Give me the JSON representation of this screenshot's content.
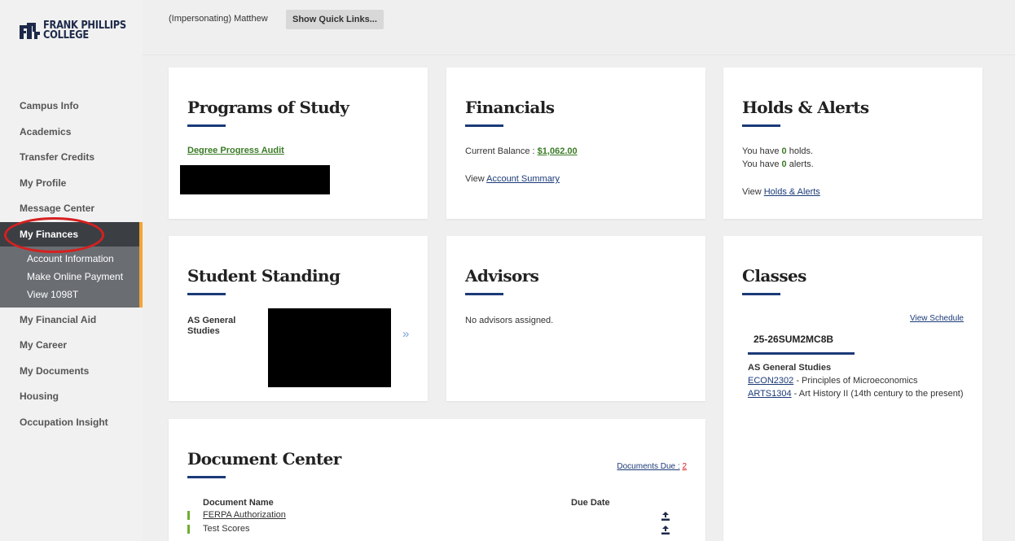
{
  "logo": {
    "line1": "FRANK PHILLIPS",
    "line2": "COLLEGE"
  },
  "sidebar": {
    "items": [
      {
        "label": "Campus Info"
      },
      {
        "label": "Academics"
      },
      {
        "label": "Transfer Credits"
      },
      {
        "label": "My Profile"
      },
      {
        "label": "Message Center"
      },
      {
        "label": "My Finances"
      },
      {
        "label": "My Financial Aid"
      },
      {
        "label": "My Career"
      },
      {
        "label": "My Documents"
      },
      {
        "label": "Housing"
      },
      {
        "label": "Occupation Insight"
      }
    ],
    "submenu": [
      {
        "label": "Account Information"
      },
      {
        "label": "Make Online Payment"
      },
      {
        "label": "View 1098T"
      }
    ]
  },
  "topbar": {
    "impersonating": "(Impersonating) Matthew",
    "quick_links": "Show Quick Links..."
  },
  "cards": {
    "programs": {
      "title": "Programs of Study",
      "link": "Degree Progress Audit"
    },
    "financials": {
      "title": "Financials",
      "balance_label": "Current Balance :",
      "balance_value": "$1,062.00",
      "view": "View",
      "account_summary": "Account Summary"
    },
    "holds": {
      "title": "Holds & Alerts",
      "holds_prefix": "You have",
      "holds_count": "0",
      "holds_suffix": "holds.",
      "alerts_prefix": "You have",
      "alerts_count": "0",
      "alerts_suffix": "alerts.",
      "view": "View",
      "link": "Holds & Alerts"
    },
    "standing": {
      "title": "Student Standing",
      "program_line1": "AS General",
      "program_line2": "Studies",
      "arrow": "»"
    },
    "advisors": {
      "title": "Advisors",
      "message": "No advisors assigned."
    },
    "classes": {
      "title": "Classes",
      "view_schedule": "View Schedule",
      "term": "25-26SUM2MC8B",
      "program": "AS General Studies",
      "courses": [
        {
          "code": "ECON2302",
          "name": " - Principles of Microeconomics"
        },
        {
          "code": "ARTS1304",
          "name": " - Art History II (14th century to the present)"
        }
      ]
    },
    "documents": {
      "title": "Document Center",
      "due_label": "Documents Due :",
      "due_count": "2",
      "col_name": "Document Name",
      "col_due": "Due Date",
      "rows": [
        {
          "name": "FERPA Authorization",
          "link": true
        },
        {
          "name": "Test Scores",
          "link": false
        }
      ]
    }
  },
  "colors": {
    "accent_navy": "#1b3a78",
    "green": "#3a7b26",
    "orange": "#f4a534",
    "annotation_red": "#d62020"
  }
}
